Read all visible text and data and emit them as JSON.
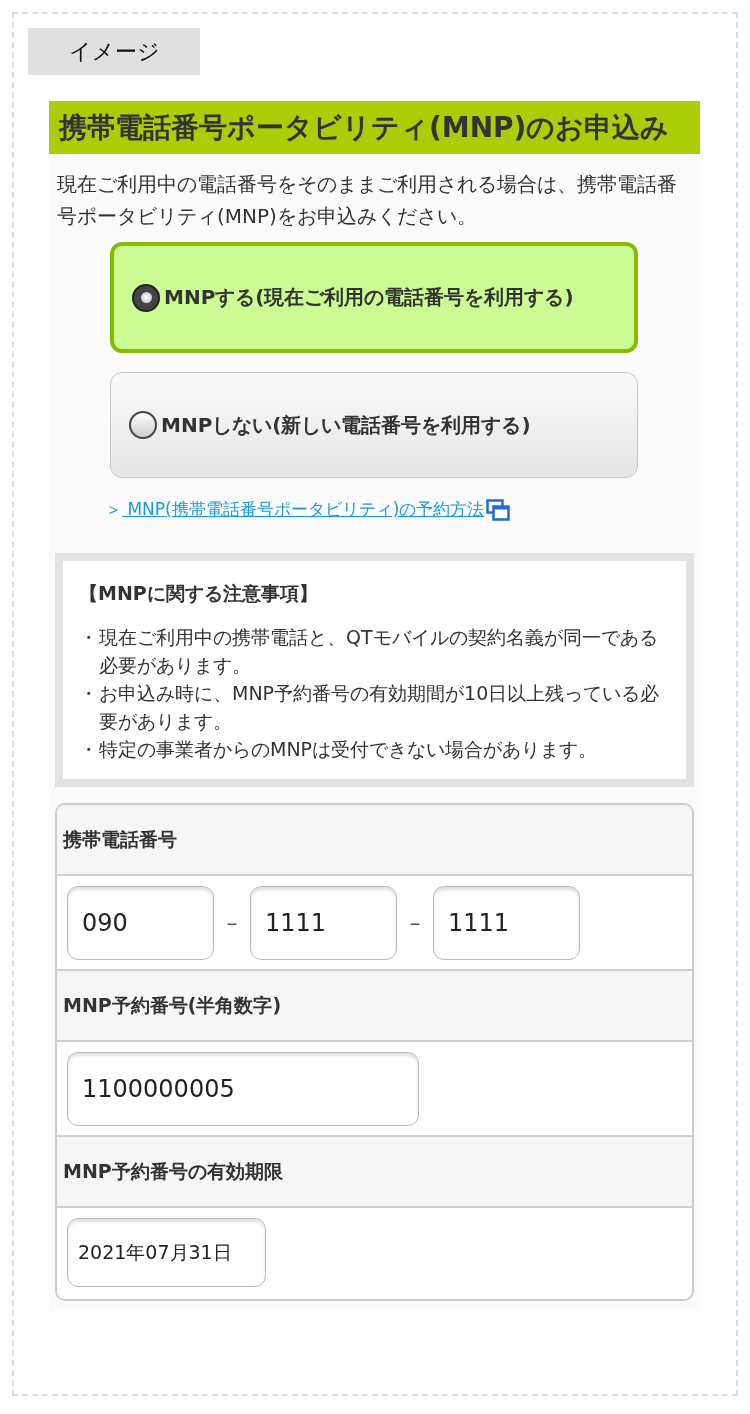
{
  "badge": "イメージ",
  "heading": "携帯電話番号ポータビリティ(MNP)のお申込み",
  "intro": "現在ご利用中の電話番号をそのままご利用される場合は、携帯電話番号ポータビリティ(MNP)をお申込みください。",
  "options": [
    {
      "label": "MNPする(現在ご利用の電話番号を利用する)",
      "selected": true
    },
    {
      "label": "MNPしない(新しい電話番号を利用する)",
      "selected": false
    }
  ],
  "link": {
    "arrow": "＞",
    "text": " MNP(携帯電話番号ポータビリティ)の予約方法"
  },
  "notes": {
    "title": "【MNPに関する注意事項】",
    "items": [
      {
        "bullet": "・",
        "text": "現在ご利用中の携帯電話と、QTモバイルの契約名義が同一である必要があります。"
      },
      {
        "bullet": "・",
        "text": "お申込み時に、MNP予約番号の有効期間が10日以上残っている必要があります。"
      },
      {
        "bullet": "・",
        "text": "特定の事業者からのMNPは受付できない場合があります。"
      }
    ]
  },
  "form": {
    "fields": [
      {
        "kind": "phone",
        "label": "携帯電話番号",
        "values": [
          "090",
          "1111",
          "1111"
        ],
        "separators": [
          "–",
          "–"
        ]
      },
      {
        "kind": "text",
        "label": "MNP予約番号(半角数字)",
        "value": "1100000005"
      },
      {
        "kind": "date",
        "label": "MNP予約番号の有効期限",
        "value": "2021年07月31日"
      }
    ]
  }
}
